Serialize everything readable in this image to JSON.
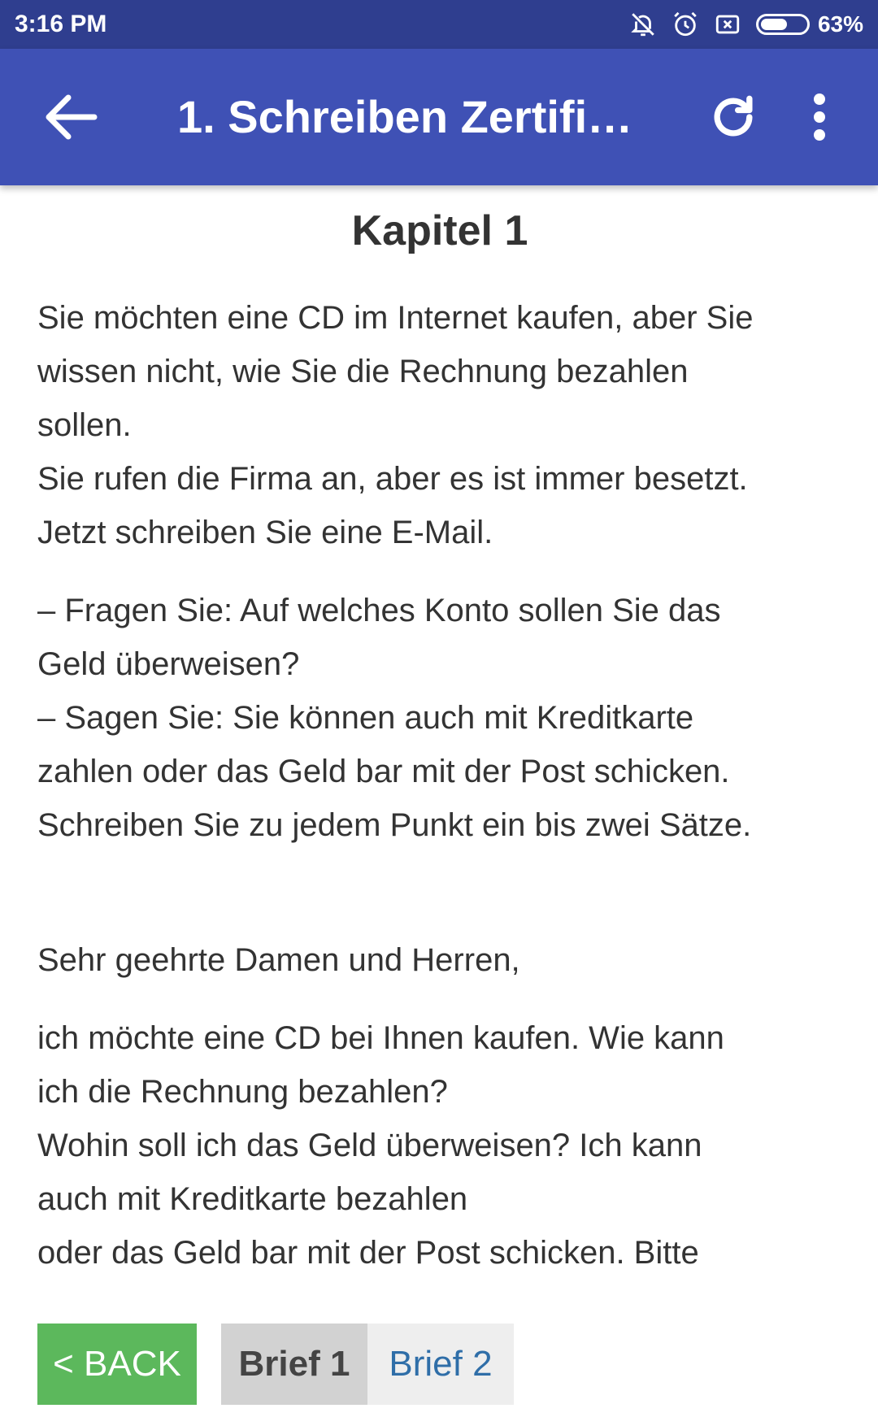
{
  "status_bar": {
    "time": "3:16 PM",
    "battery_percent": "63%",
    "battery_level": 0.63,
    "icons": [
      "bell-off-icon",
      "alarm-icon",
      "close-box-icon",
      "battery-icon"
    ]
  },
  "app_bar": {
    "title": "1. Schreiben Zertifik...",
    "icons": [
      "arrow-left-icon",
      "refresh-icon",
      "more-vert-icon"
    ],
    "color": "#3f51b5"
  },
  "content": {
    "chapter_title": "Kapitel 1",
    "task_intro": [
      "Sie möchten eine CD im Internet kaufen, aber Sie",
      "wissen nicht, wie Sie die Rechnung bezahlen",
      "sollen.",
      "Sie rufen die Firma an, aber es ist immer besetzt.",
      "Jetzt schreiben Sie eine E-Mail."
    ],
    "task_points": [
      "– Fragen Sie: Auf welches Konto sollen Sie das",
      "Geld überweisen?",
      "– Sagen Sie: Sie können auch mit Kreditkarte",
      "zahlen oder das Geld bar mit der Post schicken.",
      "Schreiben Sie zu jedem Punkt ein bis zwei Sätze."
    ],
    "letter_greeting": "Sehr geehrte Damen und Herren,",
    "letter_body": [
      "ich möchte eine CD bei Ihnen kaufen. Wie kann",
      "ich die Rechnung bezahlen?",
      "Wohin soll ich das Geld überweisen? Ich kann",
      "auch mit Kreditkarte bezahlen",
      "oder das Geld bar mit der Post schicken. Bitte"
    ]
  },
  "bottom": {
    "back_label": "< BACK",
    "tabs": [
      {
        "label": "Brief 1",
        "active": true
      },
      {
        "label": "Brief 2",
        "active": false
      }
    ],
    "back_color": "#5cb85c"
  }
}
